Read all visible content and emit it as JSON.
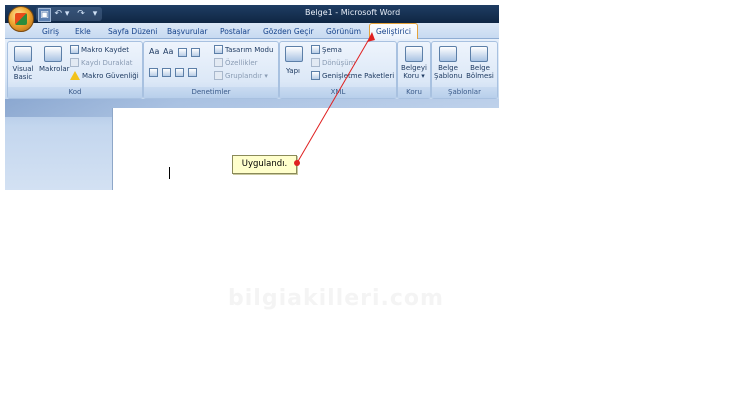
{
  "window": {
    "title": "Belge1 - Microsoft Word"
  },
  "qat": {
    "save": "▣",
    "undo": "↶ ▾",
    "redo": "↷",
    "more": "▾"
  },
  "tabs": [
    "Giriş",
    "Ekle",
    "Sayfa Düzeni",
    "Başvurular",
    "Postalar",
    "Gözden Geçir",
    "Görünüm",
    "Geliştirici"
  ],
  "active_tab": "Geliştirici",
  "groups": {
    "kod": {
      "label": "Kod",
      "visual_basic": [
        "Visual",
        "Basic"
      ],
      "makrolar": "Makrolar",
      "makro_kaydet": "Makro Kaydet",
      "kaydi_duraklat": "Kaydı Duraklat",
      "makro_guvenligi": "Makro Güvenliği"
    },
    "denetimler": {
      "label": "Denetimler",
      "tasarim_modu": "Tasarım Modu",
      "ozellikler": "Özellikler",
      "gruplandir": "Gruplandır ▾",
      "font_aa1": "Aa",
      "font_aa2": "Aa"
    },
    "xml": {
      "label": "XML",
      "yapi": "Yapı",
      "sema": "Şema",
      "donusum": "Dönüşüm",
      "genisletme": "Genişletme Paketleri"
    },
    "koru": {
      "label": "Koru",
      "belgeyi_koru": [
        "Belgeyi",
        "Koru ▾"
      ]
    },
    "sablonlar": {
      "label": "Şablonlar",
      "belge_sablonu": [
        "Belge",
        "Şablonu"
      ],
      "belge_bolmesi": [
        "Belge",
        "Bölmesi"
      ]
    }
  },
  "callout": {
    "text": "Uygulandı."
  },
  "watermark": "bilgiakilleri.com",
  "colors": {
    "accent": "#e6a33a",
    "arrow": "#e02020",
    "callout_bg": "#ffffcc"
  }
}
